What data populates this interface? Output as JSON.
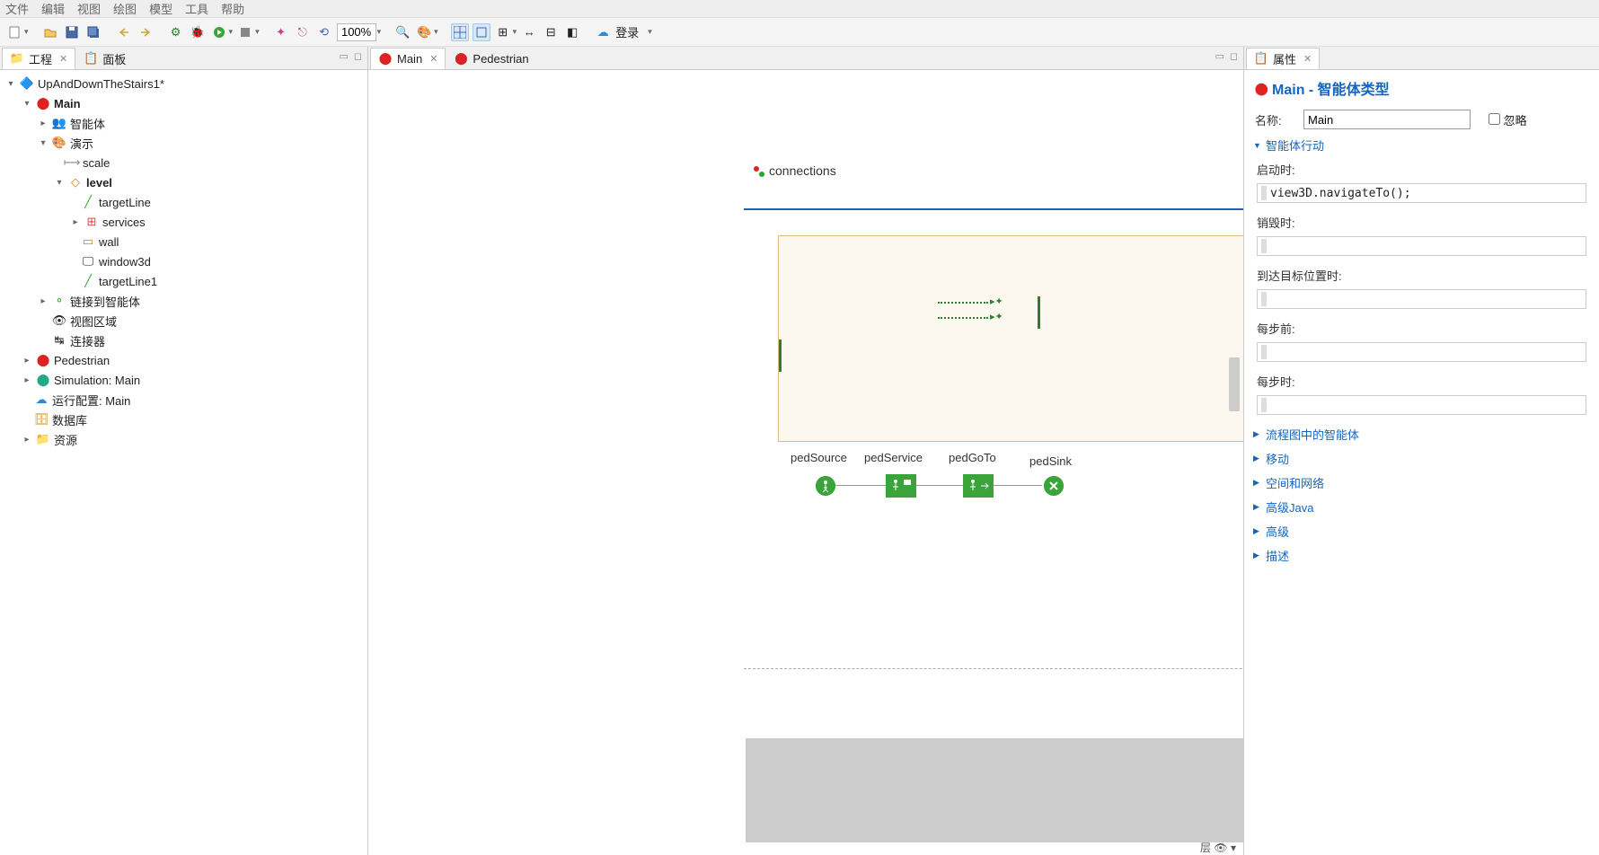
{
  "menu": {
    "file": "文件",
    "edit": "编辑",
    "view": "视图",
    "draw": "绘图",
    "model": "模型",
    "tools": "工具",
    "help": "帮助"
  },
  "toolbar": {
    "zoom": "100%",
    "login": "登录"
  },
  "leftTabs": {
    "project": "工程",
    "panel": "面板"
  },
  "tree": {
    "root": "UpAndDownTheStairs1*",
    "main": "Main",
    "agent": "智能体",
    "presentation": "演示",
    "scale": "scale",
    "level": "level",
    "targetLine": "targetLine",
    "services": "services",
    "wall": "wall",
    "window3d": "window3d",
    "targetLine1": "targetLine1",
    "linkAgent": "链接到智能体",
    "viewArea": "视图区域",
    "connectors": "连接器",
    "pedestrian": "Pedestrian",
    "simulation": "Simulation: Main",
    "runconfig": "运行配置: Main",
    "database": "数据库",
    "resources": "资源"
  },
  "editorTabs": {
    "main": "Main",
    "pedestrian": "Pedestrian"
  },
  "canvas": {
    "connections": "connections",
    "pedSource": "pedSource",
    "pedService": "pedService",
    "pedGoTo": "pedGoTo",
    "pedSink": "pedSink",
    "layer": "层"
  },
  "propsTab": "属性",
  "props": {
    "title": "Main - 智能体类型",
    "nameLabel": "名称:",
    "nameValue": "Main",
    "ignoreLabel": "忽略",
    "sections": {
      "agentActions": "智能体行动",
      "flowAgent": "流程图中的智能体",
      "movement": "移动",
      "space": "空间和网络",
      "advJava": "高级Java",
      "advanced": "高级",
      "description": "描述"
    },
    "fields": {
      "onStartup": "启动时:",
      "onStartupCode": "view3D.navigateTo();",
      "onDestroy": "销毁时:",
      "onArrival": "到达目标位置时:",
      "beforeStep": "每步前:",
      "onStep": "每步时:"
    }
  }
}
